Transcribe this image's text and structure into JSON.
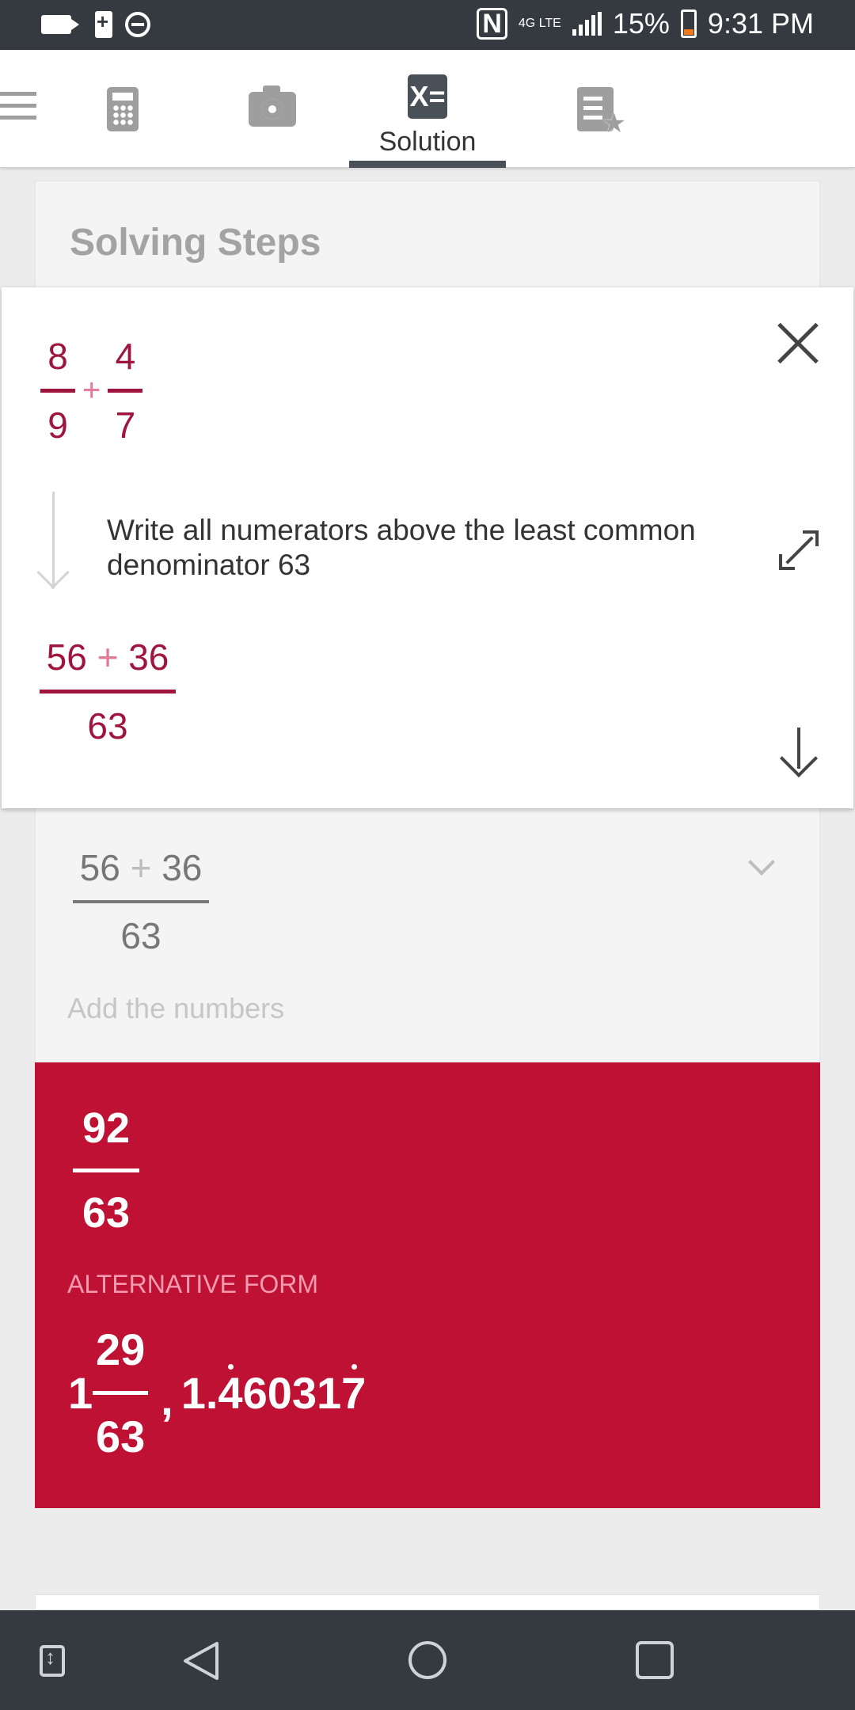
{
  "status_bar": {
    "time": "9:31 PM",
    "battery": "15%",
    "network": "4G LTE"
  },
  "tabs": {
    "solution_label": "Solution",
    "solution_glyph": "X="
  },
  "steps": {
    "title": "Solving Steps",
    "expression": {
      "a_num": "8",
      "a_den": "9",
      "op": "+",
      "b_num": "4",
      "b_den": "7"
    },
    "instruction": "Write all numerators above the least common denominator 63",
    "result": {
      "num_left": "56",
      "op": "+",
      "num_right": "36",
      "den": "63"
    }
  },
  "next_step": {
    "expression": {
      "num_left": "56",
      "op": "+",
      "num_right": "36",
      "den": "63"
    },
    "hint": "Add the numbers"
  },
  "answer": {
    "num": "92",
    "den": "63",
    "alt_label": "ALTERNATIVE FORM",
    "mixed_whole": "1",
    "mixed_num": "29",
    "mixed_den": "63",
    "comma": ",",
    "decimal_prefix": "1.",
    "decimal_repeat_start": "4",
    "decimal_middle": "6031",
    "decimal_repeat_end": "7"
  },
  "colors": {
    "accent": "#be1133",
    "math_text": "#a0153e",
    "status_bar": "#343a40"
  },
  "icons": [
    "menu-icon",
    "calculator-icon",
    "camera-icon",
    "solution-icon",
    "notebook-star-icon",
    "close-icon",
    "expand-icon",
    "down-arrow-icon",
    "chevron-down-icon"
  ]
}
